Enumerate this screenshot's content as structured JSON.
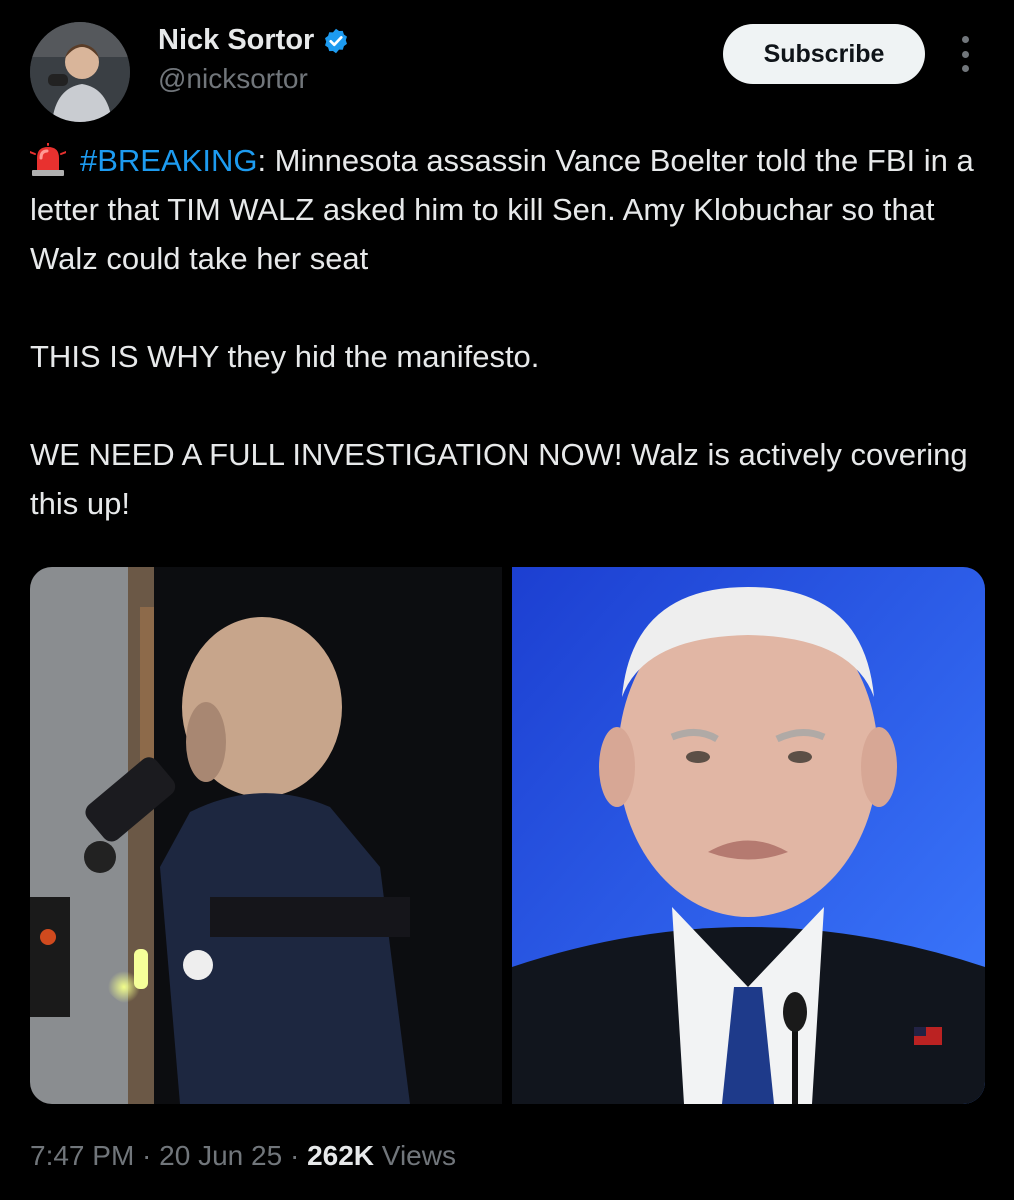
{
  "author": {
    "display_name": "Nick Sortor",
    "handle": "@nicksortor",
    "verified": true,
    "verified_icon": "verified-badge-icon",
    "avatar_icon": "avatar"
  },
  "actions": {
    "subscribe_label": "Subscribe",
    "more_icon": "more-vertical-icon"
  },
  "post": {
    "emoji": "police-siren-icon",
    "hashtag": "#BREAKING",
    "line1_rest": ": Minnesota assassin Vance Boelter told the FBI in a letter that TIM WALZ asked him to kill Sen. Amy Klobuchar so that Walz could take her seat",
    "paragraph2": "THIS IS WHY they hid the manifesto.",
    "paragraph3": "WE NEED A FULL INVESTIGATION NOW! Walz is actively covering this up!"
  },
  "media": {
    "count": 2,
    "images": [
      "photo-masked-man-with-flashlight",
      "photo-man-frowning-suit"
    ]
  },
  "meta": {
    "time": "7:47 PM",
    "sep1": " · ",
    "date": "20 Jun 25",
    "sep2": " · ",
    "views_count": "262K",
    "views_label": " Views"
  },
  "colors": {
    "background": "#000000",
    "text": "#e7e9ea",
    "secondary": "#71767b",
    "accent": "#1d9bf0"
  }
}
